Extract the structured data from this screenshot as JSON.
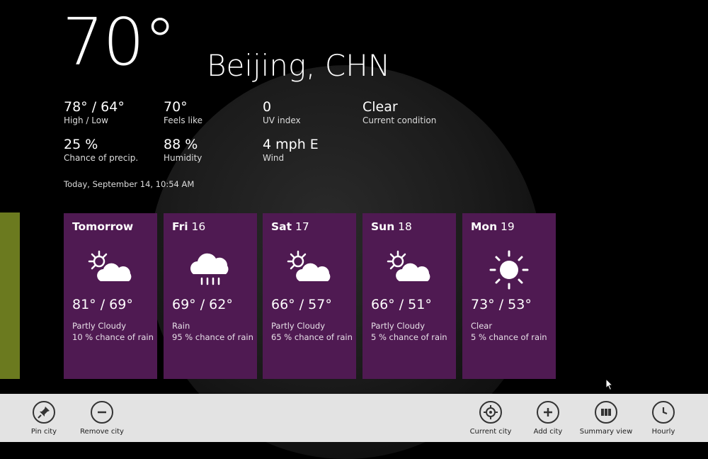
{
  "current": {
    "temp": "70°",
    "city": "Beijing, CHN",
    "timestamp": "Today, September 14, 10:54 AM"
  },
  "stats": [
    {
      "value": "78° / 64°",
      "label": "High / Low"
    },
    {
      "value": "70°",
      "label": "Feels like"
    },
    {
      "value": "0",
      "label": "UV index"
    },
    {
      "value": "Clear",
      "label": "Current condition"
    },
    {
      "value": "25 %",
      "label": "Chance of precip."
    },
    {
      "value": "88 %",
      "label": "Humidity"
    },
    {
      "value": "4 mph E",
      "label": "Wind"
    }
  ],
  "forecast": [
    {
      "day_bold": "Tomorrow",
      "day_num": "",
      "icon": "partly-cloudy-icon",
      "range": "81° / 69°",
      "condition": "Partly Cloudy",
      "rain": "10 % chance of rain"
    },
    {
      "day_bold": "Fri",
      "day_num": "16",
      "icon": "rain-icon",
      "range": "69° / 62°",
      "condition": "Rain",
      "rain": "95 % chance of rain"
    },
    {
      "day_bold": "Sat",
      "day_num": "17",
      "icon": "partly-cloudy-icon",
      "range": "66° / 57°",
      "condition": "Partly Cloudy",
      "rain": "65 % chance of rain"
    },
    {
      "day_bold": "Sun",
      "day_num": "18",
      "icon": "partly-cloudy-icon",
      "range": "66° / 51°",
      "condition": "Partly Cloudy",
      "rain": "5 % chance of rain"
    },
    {
      "day_bold": "Mon",
      "day_num": "19",
      "icon": "sun-icon",
      "range": "73° / 53°",
      "condition": "Clear",
      "rain": "5 % chance of rain"
    }
  ],
  "appbar": {
    "pin": "Pin city",
    "remove": "Remove city",
    "current": "Current city",
    "add": "Add city",
    "summary": "Summary view",
    "hourly": "Hourly"
  },
  "colors": {
    "tile": "#4f1a52",
    "strip": "#6b7a1f",
    "appbar": "#e3e3e3"
  }
}
